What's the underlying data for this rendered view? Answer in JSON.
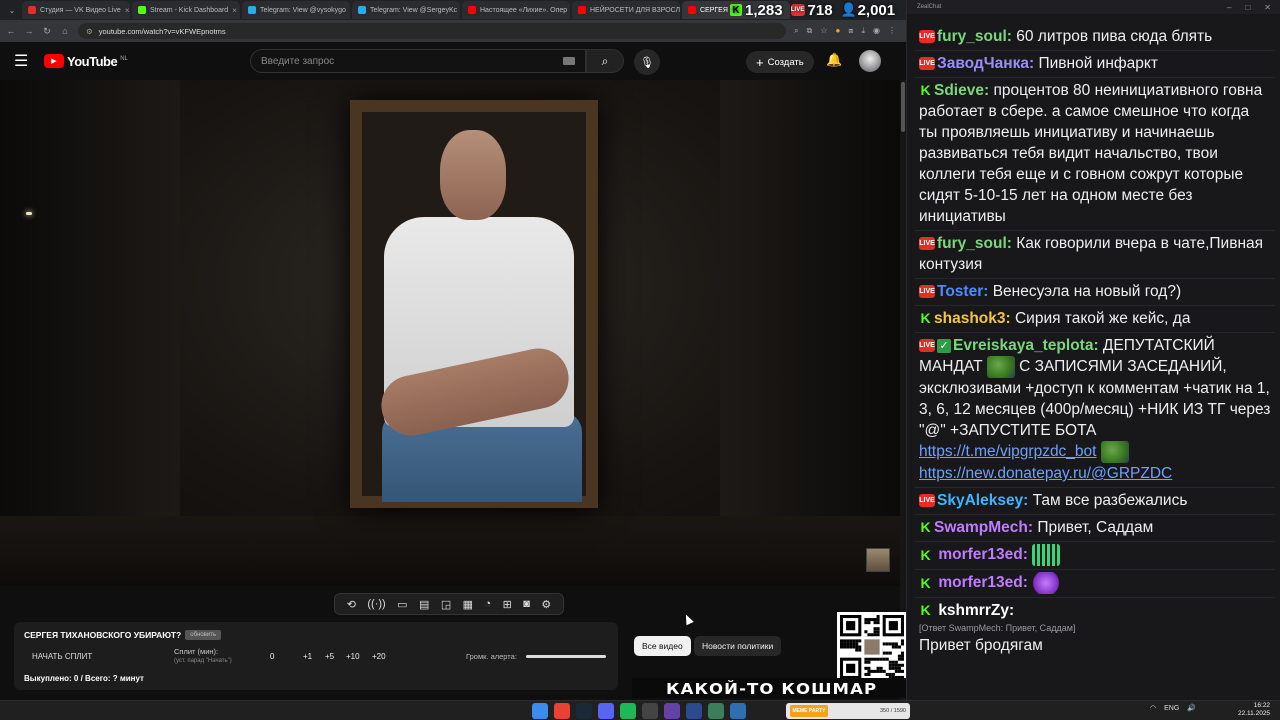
{
  "browser": {
    "tabs": [
      {
        "label": "Студия — VK Видео Live",
        "color": "#e52d27",
        "active": false
      },
      {
        "label": "Stream - Kick Dashboard",
        "color": "#53fc18",
        "active": false
      },
      {
        "label": "Telegram: View @vysokygo",
        "color": "#2aabee",
        "active": false
      },
      {
        "label": "Telegram: View @SergeyKc",
        "color": "#2aabee",
        "active": false
      },
      {
        "label": "Настоящее «Лихие». Опер",
        "color": "#ff0000",
        "active": false
      },
      {
        "label": "НЕЙРОСЕТИ ДЛЯ ВЗРОСЛ",
        "color": "#ff0000",
        "active": false
      },
      {
        "label": "СЕРГЕЯ Т",
        "color": "#ff0000",
        "active": true
      }
    ],
    "url": "youtube.com/watch?v=vKFWEpnotms"
  },
  "overlay_stats": {
    "kick_viewers": "1,283",
    "vk_viewers": "718",
    "total_viewers": "2,001"
  },
  "youtube": {
    "logo_text": "YouTube",
    "region": "NL",
    "search_placeholder": "Введите запрос",
    "create_label": "Создать",
    "chips": [
      "Все видео",
      "Новости политики"
    ]
  },
  "extension_toolbar": {
    "icons": [
      "loop-icon",
      "audio-icon",
      "screen-icon",
      "film-icon",
      "pip-icon",
      "subtitles-icon",
      "speed-icon",
      "add-icon",
      "camera-icon",
      "settings-icon"
    ]
  },
  "split_panel": {
    "title": "СЕРГЕЯ ТИХАНОВСКОГО УБИРАЮТ?",
    "update_chip": "обновить",
    "start_split": "НАЧАТЬ СПЛИТ",
    "split_label": "Сплит (мин):",
    "split_hint": "(уст. парад \"Начать\")",
    "split_value": "0",
    "increments": [
      "+1",
      "+5",
      "+10",
      "+20"
    ],
    "alert_volume_label": "Громк. алерта:",
    "alert_volume": 1.0,
    "bought": "Выкуплено: 0 / Всего: ? минут"
  },
  "thumbnail_text": "КАКОЙ-ТО КОШМАР",
  "chat": {
    "window_title": "ZealChat",
    "messages": [
      {
        "platform": "vk",
        "nick": "fury_soul:",
        "nick_color": "#7ad77a",
        "text": " 60 литров пива сюда блять"
      },
      {
        "platform": "vk",
        "nick": "ЗаводЧанка:",
        "nick_color": "#9b8cff",
        "text": " Пивной инфаркт"
      },
      {
        "platform": "kick",
        "nick": "Sdieve:",
        "nick_color": "#7ad77a",
        "text": " процентов 80 неинициативного говна работает в сбере. а самое смешное что когда ты проявляешь инициативу и начинаешь развиваться тебя видит начальство, твои коллеги тебя еще и с говном сожрут которые сидят 5-10-15 лет на одном месте без инициативы"
      },
      {
        "platform": "vk",
        "nick": "fury_soul:",
        "nick_color": "#7ad77a",
        "text": " Как говорили вчера в чате,Пивная контузия"
      },
      {
        "platform": "vk",
        "nick": "Toster:",
        "nick_color": "#4a8cff",
        "text": " Венесуэла на новый год?)"
      },
      {
        "platform": "kick",
        "nick": "shashok3:",
        "nick_color": "#f5c542",
        "text": " Сирия такой же кейс, да"
      }
    ],
    "evreiskaya": {
      "nick": "Evreiskaya_teplota:",
      "nick_color": "#7ad77a",
      "text1": " ДЕПУТАТСКИЙ МАНДАТ ",
      "text2": " С ЗАПИСЯМИ ЗАСЕДАНИЙ, эксклюзивами +доступ к комментам +чатик на 1, 3, 6, 12 месяцев (400р/месяц) +НИК ИЗ ТГ через \"@\" +ЗАПУСТИТЕ БОТА ",
      "link1": "https://t.me/vipgrpzdc_bot",
      "link2": "https://new.donatepay.ru/@GRPZDC"
    },
    "messages2": [
      {
        "platform": "vk",
        "nick": "SkyAleksey:",
        "nick_color": "#3fb5ff",
        "text": " Там все разбежались"
      },
      {
        "platform": "kick",
        "nick": "SwampMech:",
        "nick_color": "#c07bff",
        "text": " Привет, Саддам"
      }
    ],
    "morfer1": {
      "nick": "morfer13ed:",
      "nick_color": "#c07bff"
    },
    "morfer2": {
      "nick": "morfer13ed:",
      "nick_color": "#c07bff"
    },
    "kshmrr": {
      "nick": "kshmrrZy:",
      "nick_color": "#ffffff",
      "reply": "[Ответ SwampMech: Привет, Саддам]",
      "text": "Привет бродягам"
    }
  },
  "taskbar": {
    "media_progress": "350 / 1590",
    "media_label": "MEME PARTY",
    "lang": "ENG",
    "time": "16:22",
    "date": "22.11.2025"
  }
}
